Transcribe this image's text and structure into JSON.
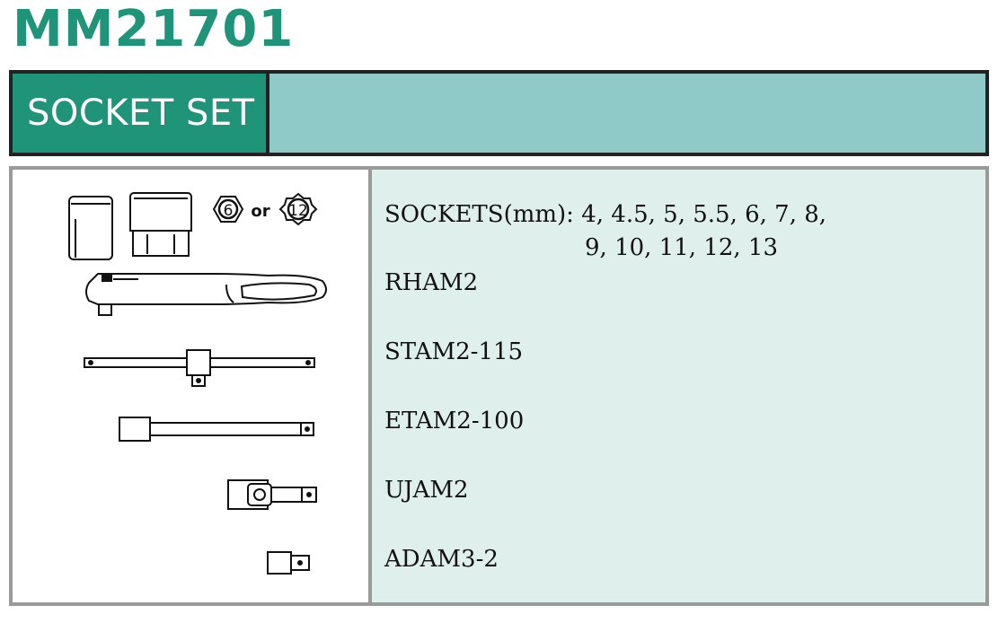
{
  "product_code": "MM21701",
  "header": {
    "label": "SOCKET SET"
  },
  "icons": {
    "hex_6": "6",
    "or": "or",
    "hex_12": "12"
  },
  "items": {
    "sockets_prefix": "SOCKETS(mm):",
    "sockets_line1": "4, 4.5, 5, 5.5, 6, 7, 8,",
    "sockets_line2": "9, 10, 11, 12, 13",
    "ratchet": "RHAM2",
    "t_bar": "STAM2-115",
    "extension": "ETAM2-100",
    "universal_joint": "UJAM2",
    "adaptor": "ADAM3-2"
  },
  "colors": {
    "brand": "#1f9479",
    "header_fill": "#8fcac8",
    "panel": "#dff0ec"
  }
}
